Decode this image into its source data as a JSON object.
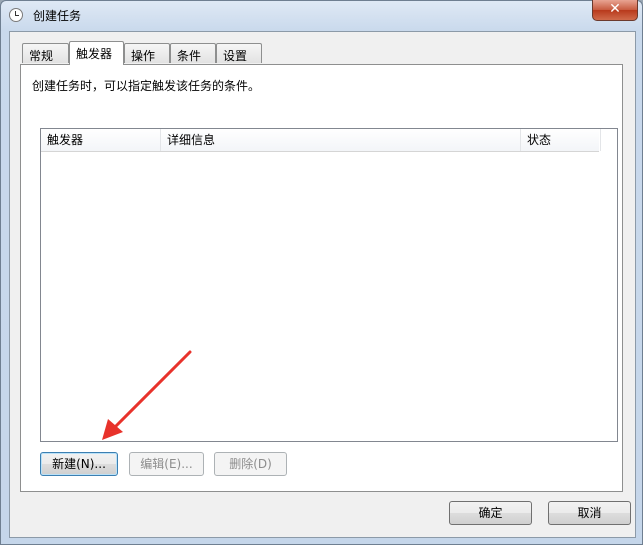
{
  "window": {
    "title": "创建任务",
    "close_symbol": "✕"
  },
  "tabs": [
    {
      "label": "常规"
    },
    {
      "label": "触发器"
    },
    {
      "label": "操作"
    },
    {
      "label": "条件"
    },
    {
      "label": "设置"
    }
  ],
  "active_tab": "触发器",
  "panel": {
    "description": "创建任务时，可以指定触发该任务的条件。",
    "columns": [
      "触发器",
      "详细信息",
      "状态"
    ],
    "rows": []
  },
  "buttons": {
    "new": "新建(N)...",
    "edit": "编辑(E)...",
    "delete": "删除(D)"
  },
  "footer": {
    "ok": "确定",
    "cancel": "取消"
  },
  "annotation": {
    "arrow_color": "#e8322b"
  }
}
